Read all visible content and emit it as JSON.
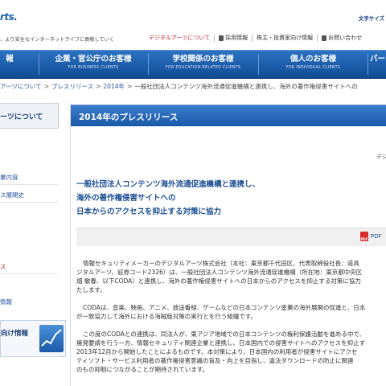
{
  "header": {
    "logo": "rts.",
    "tagline": "、より安全なインターネットライフに貢献していく",
    "text_size_label": "文字サイズ",
    "util_nav": [
      {
        "label": "デジタルアーツについて",
        "icon": "none"
      },
      {
        "label": "採用情報",
        "icon": "document-icon"
      },
      {
        "label": "株主・投資家向け情報",
        "icon": "none"
      },
      {
        "label": "お問い合わせ",
        "icon": "document-icon"
      }
    ]
  },
  "main_nav": [
    {
      "title": "報",
      "sub": ""
    },
    {
      "title": "企業・官公庁のお客様",
      "sub": "FOR BUSINESS CLIENTS"
    },
    {
      "title": "学校関係のお客様",
      "sub": "FOR EDUCATION-RELATED CLIENTS"
    },
    {
      "title": "個人のお客様",
      "sub": "FOR INDIVIDUAL CLIENTS"
    },
    {
      "title": "パー",
      "sub": ""
    }
  ],
  "breadcrumb": [
    "アーツについて",
    "プレスリリース",
    "2014年",
    "一般社団法人コンテンツ海外流通促進機構と連携し、海外の著作権侵害サイトへの"
  ],
  "sidebar": {
    "heading": "ーツについて",
    "items": [
      {
        "label": "業内容"
      },
      {
        "label": "ス展開史"
      },
      {
        "label": "ス"
      },
      {
        "label": "情報"
      }
    ],
    "banner_label": "向け情報"
  },
  "content": {
    "section_title": "2014年のプレスリリース",
    "right_label": "デジ",
    "headline": [
      "一般社団法人コンテンツ海外流通促進機構と連携し、",
      "海外の著作権侵害サイトへの",
      "日本からのアクセスを抑止する対策に協力"
    ],
    "pdf_label": "PDF",
    "paragraphs": [
      "情報セキュリティメーカーのデジタルアーツ株式会社（本社：東京都千代田区、代表取締役社長：道具",
      "ジタルアーツ、証券コード2326）は、一般社団法人コンテンツ海外流通促進機構（所在地：東京都中央区",
      "畑 敏春、以下CODA）と連携し、海外の著作権侵害サイトへの日本からのアクセスを抑止する対策に協力",
      "たします。",
      "CODAは、音楽、映画、アニメ、放送番組、ゲームなどの日本コンテンツ産業の海外展開の促進と、日本",
      "が一致協力して海外における海賊版対策の実行とを行う組織です。",
      "この度のCODAとの連携は、同法人が、東アジア地域での日本コンテンツの権利保護活動を進める中で、",
      "擁発要請を行う一方、情報セキュリティ関連企業と連携し、日本国内での侵害サイトへのアクセスを抑止す",
      "2013年12月から開始したことによるものです。本対策により、日本国内の利用者が侵害サイトにアクセ",
      "ティソフト・サービス利用者の著作権侵害意識の盲及・向上を目指し、違法ダウンロードの防止に関連",
      "のもの抑制につながることが期待されています。"
    ]
  }
}
